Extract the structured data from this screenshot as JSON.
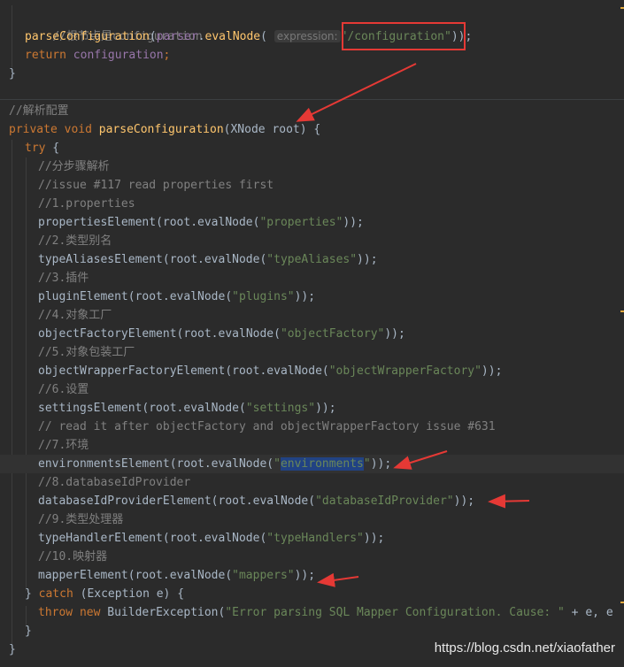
{
  "editor": {
    "top": {
      "comment": "//根节点是configuration",
      "parse_method": "parseConfiguration",
      "parser_var": "parser",
      "dot": ".",
      "eval_method": "evalNode",
      "open_paren": "(",
      "hint_label": "expression:",
      "arg": "\"/configuration\"",
      "close": "));",
      "ret_kw": "return",
      "ret_field": "configuration",
      "semi": ";",
      "brace": "}"
    },
    "method": {
      "comment": "//解析配置",
      "kw_private": "private",
      "kw_void": "void",
      "name": "parseConfiguration",
      "params": "(XNode root) {",
      "try_kw": "try",
      "try_brace": " {"
    },
    "lines": [
      {
        "comment": "//分步骤解析"
      },
      {
        "comment": "//issue #117 read properties first"
      },
      {
        "comment": "//1.properties"
      },
      {
        "call": "propertiesElement",
        "arg": "\"properties\""
      },
      {
        "comment": "//2.类型别名"
      },
      {
        "call": "typeAliasesElement",
        "arg": "\"typeAliases\""
      },
      {
        "comment": "//3.插件"
      },
      {
        "call": "pluginElement",
        "arg": "\"plugins\""
      },
      {
        "comment": "//4.对象工厂"
      },
      {
        "call": "objectFactoryElement",
        "arg": "\"objectFactory\""
      },
      {
        "comment": "//5.对象包装工厂"
      },
      {
        "call": "objectWrapperFactoryElement",
        "arg": "\"objectWrapperFactory\""
      },
      {
        "comment": "//6.设置"
      },
      {
        "call": "settingsElement",
        "arg": "\"settings\""
      },
      {
        "comment": "// read it after objectFactory and objectWrapperFactory issue #631"
      },
      {
        "comment": "//7.环境"
      },
      {
        "call": "environmentsElement",
        "arg_quote_open": "\"",
        "arg_selected": "environments",
        "arg_quote_close": "\""
      },
      {
        "comment": "//8.databaseIdProvider"
      },
      {
        "call": "databaseIdProviderElement",
        "arg": "\"databaseIdProvider\""
      },
      {
        "comment": "//9.类型处理器"
      },
      {
        "call": "typeHandlerElement",
        "arg": "\"typeHandlers\""
      },
      {
        "comment": "//10.映射器"
      },
      {
        "call": "mapperElement",
        "arg": "\"mappers\""
      }
    ],
    "call_mid": "(root.evalNode(",
    "call_end": "));",
    "catch": {
      "brace": "} ",
      "kw": "catch",
      "rest": " (Exception e) {"
    },
    "throw": {
      "kw_throw": "throw",
      "kw_new": "new",
      "cls": "BuilderException(",
      "msg": "\"Error parsing SQL Mapper Configuration. Cause: \"",
      "rest": " + e, e"
    },
    "close_inner": "}",
    "close_outer": "}"
  },
  "watermark": "https://blog.csdn.net/xiaofather",
  "colors": {
    "background": "#2b2b2b",
    "keyword": "#cc7832",
    "string": "#6a8759",
    "method": "#ffc66d",
    "field": "#9876aa",
    "comment": "#808080",
    "annotation_red": "#e53935"
  }
}
